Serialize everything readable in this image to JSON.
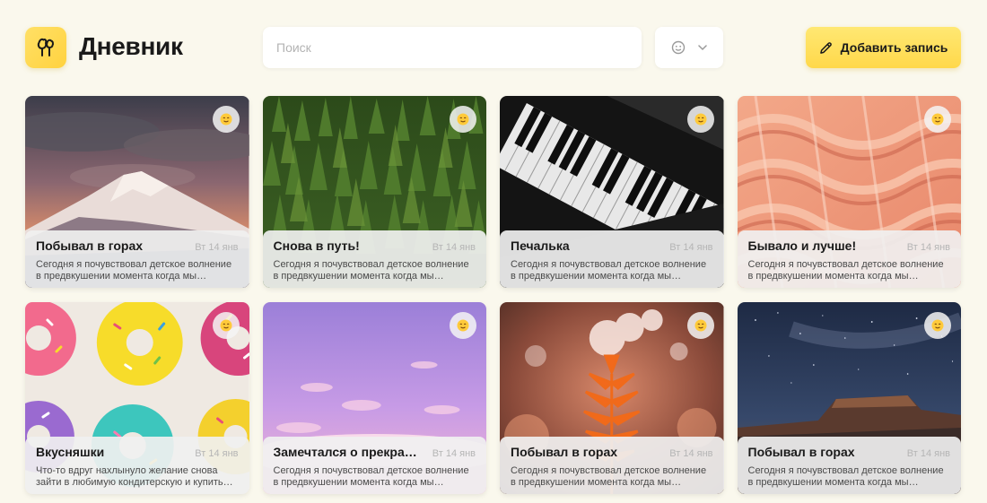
{
  "header": {
    "title": "Дневник",
    "search_placeholder": "Поиск",
    "add_button_label": "Добавить запись"
  },
  "colors": {
    "background": "#faf8ed",
    "accent": "#ffd84a",
    "card_panel": "#f0f0f0"
  },
  "entries": [
    {
      "title": "Побывал в горах",
      "date": "Вт 14 янв",
      "text": "Сегодня я почувствовал детское волнение в предвкушении момента когда мы заберемся на вершину",
      "image": "mountain-sunset",
      "mood_icon": "smiling-emoji-icon"
    },
    {
      "title": "Снова в путь!",
      "date": "Вт 14 янв",
      "text": "Сегодня я почувствовал детское волнение в предвкушении момента когда мы заберемся на вершину",
      "image": "pine-forest",
      "mood_icon": "smiling-emoji-icon"
    },
    {
      "title": "Печалька",
      "date": "Вт 14 янв",
      "text": "Сегодня я почувствовал детское волнение в предвкушении момента когда мы заберемся на вершину",
      "image": "piano-keys",
      "mood_icon": "smiling-emoji-icon"
    },
    {
      "title": "Бывало и лучше!",
      "date": "Вт 14 янв",
      "text": "Сегодня я почувствовал детское волнение в предвкушении момента когда мы заберемся на вершину",
      "image": "knitted-rope",
      "mood_icon": "smiling-emoji-icon"
    },
    {
      "title": "Вкусняшки",
      "date": "Вт 14 янв",
      "text": "Что-то вдруг нахлынуло желание снова зайти в любимую кондитерскую и купить что-нибудь вкусное",
      "image": "donuts",
      "mood_icon": "smiling-emoji-icon"
    },
    {
      "title": "Замечтался о прекрасном",
      "date": "Вт 14 янв",
      "text": "Сегодня я почувствовал детское волнение в предвкушении момента когда мы заберемся на вершину",
      "image": "pink-sky",
      "mood_icon": "smiling-emoji-icon"
    },
    {
      "title": "Побывал в горах",
      "date": "Вт 14 янв",
      "text": "Сегодня я почувствовал детское волнение в предвкушении момента когда мы заберемся на вершину",
      "image": "autumn-leaf",
      "mood_icon": "smiling-emoji-icon"
    },
    {
      "title": "Побывал в горах",
      "date": "Вт 14 янв",
      "text": "Сегодня я почувствовал детское волнение в предвкушении момента когда мы заберемся на вершину",
      "image": "night-mesa",
      "mood_icon": "smiling-emoji-icon"
    }
  ]
}
